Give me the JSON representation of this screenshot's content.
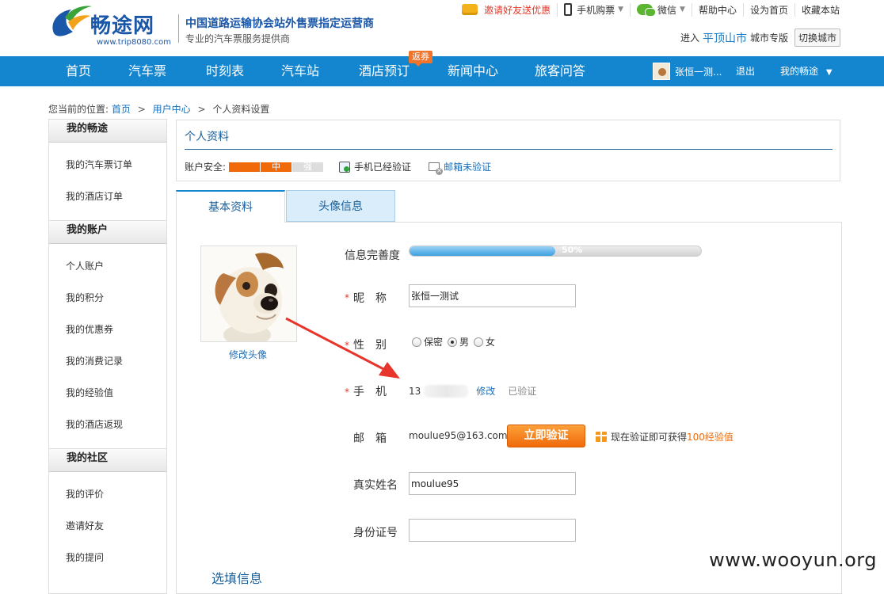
{
  "brand": {
    "name": "畅途网",
    "url": "www.trip8080.com",
    "slogan_main": "中国道路运输协会站外售票指定运营商",
    "slogan_sub": "专业的汽车票服务提供商"
  },
  "toplinks": {
    "invite": "邀请好友送优惠",
    "mobile": "手机购票",
    "wechat": "微信",
    "help": "帮助中心",
    "homepage": "设为首页",
    "favorite": "收藏本站"
  },
  "city": {
    "prefix": "进入",
    "name": "平顶山市",
    "suffix": "城市专版",
    "switch": "切换城市"
  },
  "nav": {
    "items": [
      "首页",
      "汽车票",
      "时刻表",
      "汽车站",
      "酒店预订",
      "新闻中心",
      "旅客问答"
    ],
    "badge": "返券",
    "username": "张恒一测...",
    "logout": "退出",
    "my_account": "我的畅途"
  },
  "breadcrumb": {
    "prefix": "您当前的位置:",
    "items": [
      "首页",
      "用户中心",
      "个人资料设置"
    ]
  },
  "sidebar": {
    "groups": [
      {
        "title": "我的畅途",
        "items": [
          "我的汽车票订单",
          "我的酒店订单"
        ]
      },
      {
        "title": "我的账户",
        "items": [
          "个人账户",
          "我的积分",
          "我的优惠券",
          "我的消费记录",
          "我的经验值",
          "我的酒店返现"
        ]
      },
      {
        "title": "我的社区",
        "items": [
          "我的评价",
          "邀请好友",
          "我的提问"
        ]
      }
    ]
  },
  "profile": {
    "title": "个人资料",
    "security_label": "账户安全:",
    "security_levels": [
      "",
      "中",
      "强"
    ],
    "security_level_current": "中",
    "phone_status": "手机已经验证",
    "email_status": "邮箱未验证"
  },
  "tabs": [
    "基本资料",
    "头像信息"
  ],
  "form": {
    "avatar_link": "修改头像",
    "completeness_label": "信息完善度",
    "completeness_value": 0.5,
    "completeness_text": "50%",
    "nickname_label": "昵　称",
    "nickname_value": "张恒一测试",
    "gender_label": "性　别",
    "gender_options": [
      "保密",
      "男",
      "女"
    ],
    "gender_selected": "男",
    "phone_label": "手　机",
    "phone_value": "13",
    "phone_edit": "修改",
    "phone_verified": "已验证",
    "email_label": "邮　箱",
    "email_value": "moulue95@163.com",
    "verify_button": "立即验证",
    "reward_prefix": "现在验证即可获得",
    "reward_value": "100经验值",
    "realname_label": "真实姓名",
    "realname_value": "moulue95",
    "idcard_label": "身份证号",
    "idcard_value": "",
    "optional_title": "选填信息"
  },
  "watermark": "www.wooyun.org",
  "colors": {
    "nav_blue": "#1486cf",
    "brand_blue": "#1a57a8",
    "accent_orange": "#f06a0a",
    "link_blue": "#1a6fb8",
    "alert_red": "#e5382a",
    "arrow_red": "#e8352b"
  }
}
